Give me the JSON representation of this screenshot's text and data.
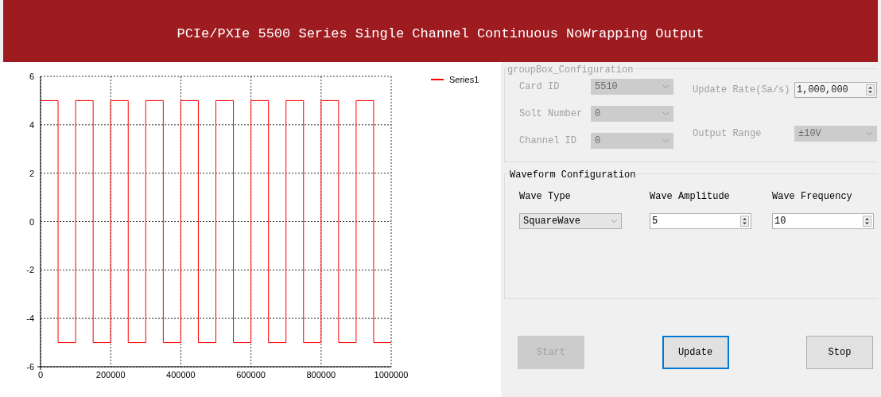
{
  "title": "PCIe/PXIe 5500 Series Single Channel Continuous NoWrapping Output",
  "chart": {
    "chart_data": {
      "type": "line",
      "x": [
        0,
        50000,
        50000,
        100000,
        100000,
        150000,
        150000,
        200000,
        200000,
        250000,
        250000,
        300000,
        300000,
        350000,
        350000,
        400000,
        400000,
        450000,
        450000,
        500000,
        500000,
        550000,
        550000,
        600000,
        600000,
        650000,
        650000,
        700000,
        700000,
        750000,
        750000,
        800000,
        800000,
        850000,
        850000,
        900000,
        900000,
        950000,
        950000,
        1000000
      ],
      "series": [
        {
          "name": "Series1",
          "color": "#ff0000",
          "values": [
            5,
            5,
            -5,
            -5,
            5,
            5,
            -5,
            -5,
            5,
            5,
            -5,
            -5,
            5,
            5,
            -5,
            -5,
            5,
            5,
            -5,
            -5,
            5,
            5,
            -5,
            -5,
            5,
            5,
            -5,
            -5,
            5,
            5,
            -5,
            -5,
            5,
            5,
            -5,
            -5,
            5,
            5,
            -5,
            -5
          ]
        }
      ],
      "grid": true,
      "xlim": [
        0,
        1000000
      ],
      "ylim": [
        -6,
        6
      ],
      "xticks": [
        0,
        200000,
        400000,
        600000,
        800000,
        1000000
      ],
      "yticks": [
        -6,
        -4,
        -2,
        0,
        2,
        4,
        6
      ]
    }
  },
  "config_group": {
    "title": "groupBox_Configuration",
    "fields": [
      {
        "label": "Card ID",
        "value": "5510",
        "kind": "combo",
        "disabled": true
      },
      {
        "label": "Solt Number",
        "value": "0",
        "kind": "combo",
        "disabled": true
      },
      {
        "label": "Channel ID",
        "value": "0",
        "kind": "combo",
        "disabled": true
      },
      {
        "label": "Update Rate(Sa/s)",
        "value": "1,000,000",
        "kind": "spin",
        "disabled": true
      },
      {
        "label": "Output Range",
        "value": "±10V",
        "kind": "combo",
        "disabled": true
      }
    ]
  },
  "waveform_group": {
    "title": "Waveform Configuration",
    "fields": [
      {
        "label": "Wave Type",
        "value": "SquareWave",
        "kind": "combo",
        "disabled": false
      },
      {
        "label": "Wave Amplitude",
        "value": "5",
        "kind": "spin",
        "disabled": false
      },
      {
        "label": "Wave Frequency",
        "value": "10",
        "kind": "spin",
        "disabled": false
      }
    ]
  },
  "buttons": [
    {
      "label": "Start",
      "disabled": true,
      "focused": false
    },
    {
      "label": "Update",
      "disabled": false,
      "focused": true
    },
    {
      "label": "Stop",
      "disabled": false,
      "focused": false
    }
  ]
}
